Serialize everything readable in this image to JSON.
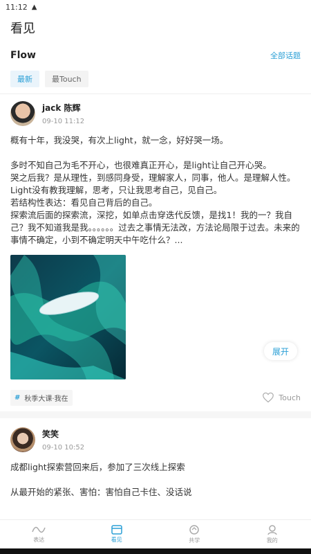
{
  "status": {
    "time": "11:12",
    "warn_icon": "warning-icon"
  },
  "appbar": {
    "title": "看见"
  },
  "flow": {
    "title": "Flow",
    "all_topics": "全部话题"
  },
  "tabs": [
    {
      "label": "最新"
    },
    {
      "label": "最Touch"
    }
  ],
  "posts": [
    {
      "user": "jack 陈辉",
      "time": "09-10 11:12",
      "paragraphs": [
        "概有十年，我没哭，有次上light，就一念，好好哭一场。",
        "多时不知自己为毛不开心，也很难真正开心，是light让自己开心哭。\n哭之后我？是从理性，到感同身受，理解家人，同事，他人。是理解人性。\nLight没有教我理解，思考，只让我思考自己，见自己。\n若结构性表达：看见自己背后的自己。\n探索流后面的探索流，深挖，如单点击穿迭代反馈，是找1！我的一？我自己？我不知道我是我。。。。。。过去之事情无法改，方法论局限于过去。未来的事情不确定，小到不确定明天中午吃什么？..."
      ],
      "expand": "展开",
      "tag": "秋季大课·我在",
      "like": "Touch"
    },
    {
      "user": "笑笑",
      "time": "09-10 10:52",
      "paragraphs": [
        "成都light探索营回来后，参加了三次线上探索",
        "从最开始的紧张、害怕：害怕自己卡住、没话说"
      ]
    }
  ],
  "nav": [
    {
      "label": "表达",
      "icon": "wave-icon"
    },
    {
      "label": "看见",
      "icon": "cards-icon"
    },
    {
      "label": "共学",
      "icon": "cycle-icon"
    },
    {
      "label": "我的",
      "icon": "person-icon"
    }
  ],
  "colors": {
    "accent": "#2a9fd6"
  }
}
